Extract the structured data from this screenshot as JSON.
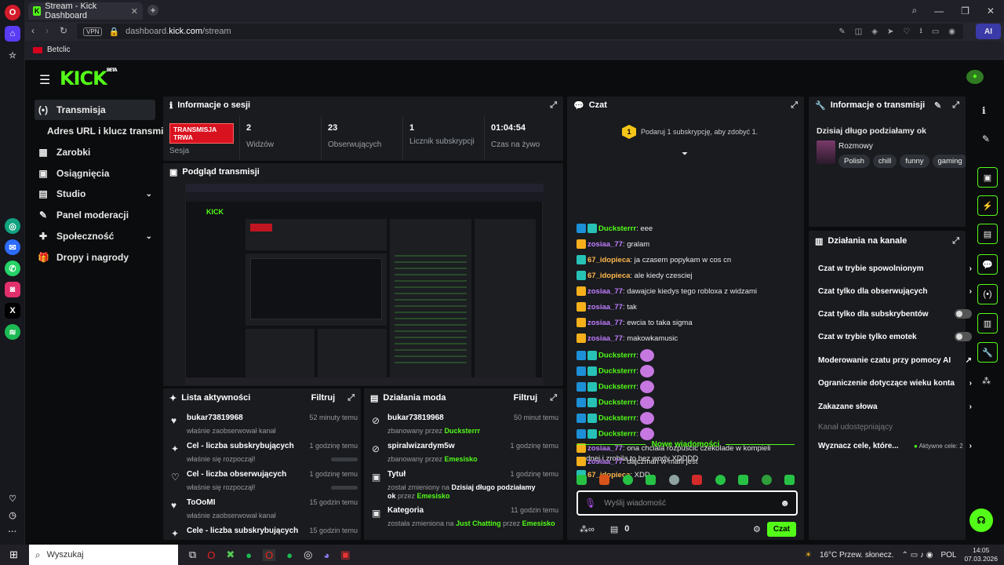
{
  "browser": {
    "tab_title": "Stream - Kick Dashboard",
    "url_prefix": "dashboard.",
    "url_domain": "kick.com",
    "url_path": "/stream",
    "vpn": "VPN",
    "ai": "AI",
    "bookmark": "Betclic"
  },
  "brand": {
    "logo": "KICK",
    "beta": "BETA",
    "accent": "#53fc18"
  },
  "nav": [
    {
      "label": "Transmisja",
      "icon": "(•)"
    },
    {
      "label": "Adres URL i klucz transmisji",
      "icon": ""
    },
    {
      "label": "Zarobki",
      "icon": "▦"
    },
    {
      "label": "Osiągnięcia",
      "icon": "▣"
    },
    {
      "label": "Studio",
      "icon": "▤"
    },
    {
      "label": "Panel moderacji",
      "icon": "✎"
    },
    {
      "label": "Społeczność",
      "icon": "✚"
    },
    {
      "label": "Dropy i nagrody",
      "icon": "🎁"
    }
  ],
  "session": {
    "title": "Informacje o sesji",
    "live": "TRANSMISJA TRWA",
    "sesja": "Sesja",
    "stats": [
      {
        "v": "2",
        "l": "Widzów"
      },
      {
        "v": "23",
        "l": "Obserwujących"
      },
      {
        "v": "1",
        "l": "Licznik subskrypcji"
      },
      {
        "v": "01:04:54",
        "l": "Czas na żywo"
      }
    ]
  },
  "preview": {
    "title": "Podgląd transmisji"
  },
  "activity": {
    "title": "Lista aktywności",
    "filter": "Filtruj",
    "items": [
      {
        "t": "bukar73819968",
        "s": "właśnie zaobserwował kanał",
        "tm": "52 minuty temu",
        "i": "♥"
      },
      {
        "t": "Cel - liczba subskrybujących",
        "s": "właśnie się rozpoczął!",
        "tm": "1 godzinę temu",
        "i": "✦"
      },
      {
        "t": "Cel - liczba obserwujących",
        "s": "właśnie się rozpoczął!",
        "tm": "1 godzinę temu",
        "i": "♡"
      },
      {
        "t": "ToOoMI",
        "s": "właśnie zaobserwował kanał",
        "tm": "15 godzin temu",
        "i": "♥"
      },
      {
        "t": "Cele - liczba subskrybujących",
        "s": "",
        "tm": "15 godzin temu",
        "i": "✦"
      }
    ]
  },
  "mod": {
    "title": "Działania moda",
    "filter": "Filtruj",
    "items": [
      {
        "t": "bukar73819968",
        "s": "zbanowany przez ",
        "g": "Ducksterrr",
        "tm": "50 minut temu"
      },
      {
        "t": "spiralwizardym5w",
        "s": "zbanowany przez ",
        "g": "Emesisko",
        "tm": "1 godzinę temu"
      },
      {
        "t": "Tytuł",
        "s": "został zmieniony na ",
        "bold": "Dzisiaj długo podziałamy ok",
        "s2": " przez ",
        "g": "Emesisko",
        "tm": "1 godzinę temu"
      },
      {
        "t": "Kategoria",
        "s": "została zmieniona na ",
        "g2": "Just Chatting",
        "s2": " przez ",
        "g": "Emesisko",
        "tm": "11 godzin temu"
      }
    ]
  },
  "chat": {
    "title": "Czat",
    "sub_prompt": "Podaruj 1 subskrypcję, aby zdobyć 1.",
    "sub_badge": "1",
    "new_msgs": "Nowe wiadomości",
    "placeholder": "Wyślij wiadomość",
    "send": "Czat",
    "count": "0",
    "messages": [
      {
        "u": "Ducksterrr",
        "c": "#53fc18",
        "t": "eee",
        "badge": "mod"
      },
      {
        "u": "zosiaa_77",
        "c": "#c17dff",
        "t": "gralam",
        "badge": "crown"
      },
      {
        "u": "67_idopieca",
        "c": "#ffb84d",
        "t": "ja czasem popykam w cos cn",
        "badge": "sub"
      },
      {
        "u": "67_idopieca",
        "c": "#ffb84d",
        "t": "ale kiedy czesciej",
        "badge": "sub"
      },
      {
        "u": "zosiaa_77",
        "c": "#c17dff",
        "t": "dawajcie kiedys tego robloxa z widzami",
        "badge": "crown"
      },
      {
        "u": "zosiaa_77",
        "c": "#c17dff",
        "t": "tak",
        "badge": "crown"
      },
      {
        "u": "zosiaa_77",
        "c": "#c17dff",
        "t": "ewcia to taka sigma",
        "badge": "crown"
      },
      {
        "u": "zosiaa_77",
        "c": "#c17dff",
        "t": "makowkamusic",
        "badge": "crown"
      },
      {
        "u": "Ducksterrr",
        "c": "#53fc18",
        "t": "",
        "badge": "mod",
        "emote": true
      },
      {
        "u": "Ducksterrr",
        "c": "#53fc18",
        "t": "",
        "badge": "mod",
        "emote": true
      },
      {
        "u": "Ducksterrr",
        "c": "#53fc18",
        "t": "",
        "badge": "mod",
        "emote": true
      },
      {
        "u": "Ducksterrr",
        "c": "#53fc18",
        "t": "",
        "badge": "mod",
        "emote": true
      },
      {
        "u": "Ducksterrr",
        "c": "#53fc18",
        "t": "",
        "badge": "mod",
        "emote": true
      },
      {
        "u": "Ducksterrr",
        "c": "#53fc18",
        "t": "",
        "badge": "mod",
        "emote": true
      },
      {
        "u": "zosiaa_77",
        "c": "#c17dff",
        "t": "ona chciala rozpuscic czekolade w kompieli wodnej i zrobila to bez wody XDDDD",
        "badge": "crown"
      },
      {
        "u": "67_idopieca",
        "c": "#ffb84d",
        "t": "XDD",
        "badge": "sub"
      }
    ],
    "after": {
      "u": "zosiaa_77",
      "c": "#c17dff",
      "t": "dajczman w mafii jest",
      "badge": "crown"
    }
  },
  "info": {
    "title": "Informacje o transmisji",
    "stream_title": "Dzisiaj długo podziałamy ok",
    "category": "Rozmowy",
    "tags": [
      "Polish",
      "chill",
      "funny",
      "gaming"
    ]
  },
  "channel": {
    "title": "Działania na kanale",
    "rows": [
      {
        "l": "Czat w trybie spowolnionym",
        "k": "chev"
      },
      {
        "l": "Czat tylko dla obserwujących",
        "k": "chev"
      },
      {
        "l": "Czat tylko dla subskrybentów",
        "k": "tog"
      },
      {
        "l": "Czat w trybie tylko emotek",
        "k": "tog"
      },
      {
        "l": "Moderowanie czatu przy pomocy AI",
        "k": "ext"
      },
      {
        "l": "Ograniczenie dotyczące wieku konta",
        "k": "chev"
      },
      {
        "l": "Zakazane słowa",
        "k": "chev"
      },
      {
        "l": "Kanał udostępniający",
        "k": "dim"
      }
    ],
    "goals": "Wyznacz cele, które...",
    "goals_active": "Aktywne cele: 2"
  },
  "taskbar": {
    "search": "Wyszukaj",
    "weather": "16°C  Przew. słonecz.",
    "lang": "POL",
    "time": "14:05",
    "date": "07.03.2026"
  }
}
